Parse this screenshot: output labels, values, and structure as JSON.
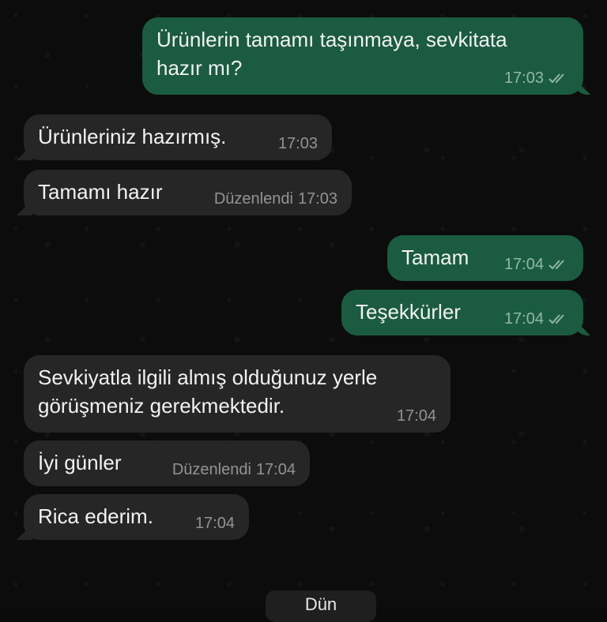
{
  "chat": {
    "messages": [
      {
        "direction": "outgoing",
        "text": "Ürünlerin tamamı taşınmaya, sevkitata\nhazır mı?",
        "time": "17:03",
        "edited": "",
        "status": "read"
      },
      {
        "direction": "incoming",
        "text": "Ürünleriniz hazırmış.",
        "time": "17:03",
        "edited": ""
      },
      {
        "direction": "incoming",
        "text": "Tamamı hazır",
        "time": "17:03",
        "edited": "Düzenlendi"
      },
      {
        "direction": "outgoing",
        "text": "Tamam",
        "time": "17:04",
        "edited": "",
        "status": "read"
      },
      {
        "direction": "outgoing",
        "text": "Teşekkürler",
        "time": "17:04",
        "edited": "",
        "status": "read"
      },
      {
        "direction": "incoming",
        "text": "Sevkiyatla ilgili almış olduğunuz yerle\ngörüşmeniz gerekmektedir.",
        "time": "17:04",
        "edited": ""
      },
      {
        "direction": "incoming",
        "text": "İyi günler",
        "time": "17:04",
        "edited": "Düzenlendi"
      },
      {
        "direction": "incoming",
        "text": "Rica ederim.",
        "time": "17:04",
        "edited": ""
      }
    ],
    "date_separator": "Dün"
  },
  "colors": {
    "background": "#0b0b0b",
    "outgoing_bubble": "#1a5b41",
    "incoming_bubble": "#262626",
    "text": "#f2f2f2"
  },
  "icons": {
    "status": "double-check-icon"
  }
}
